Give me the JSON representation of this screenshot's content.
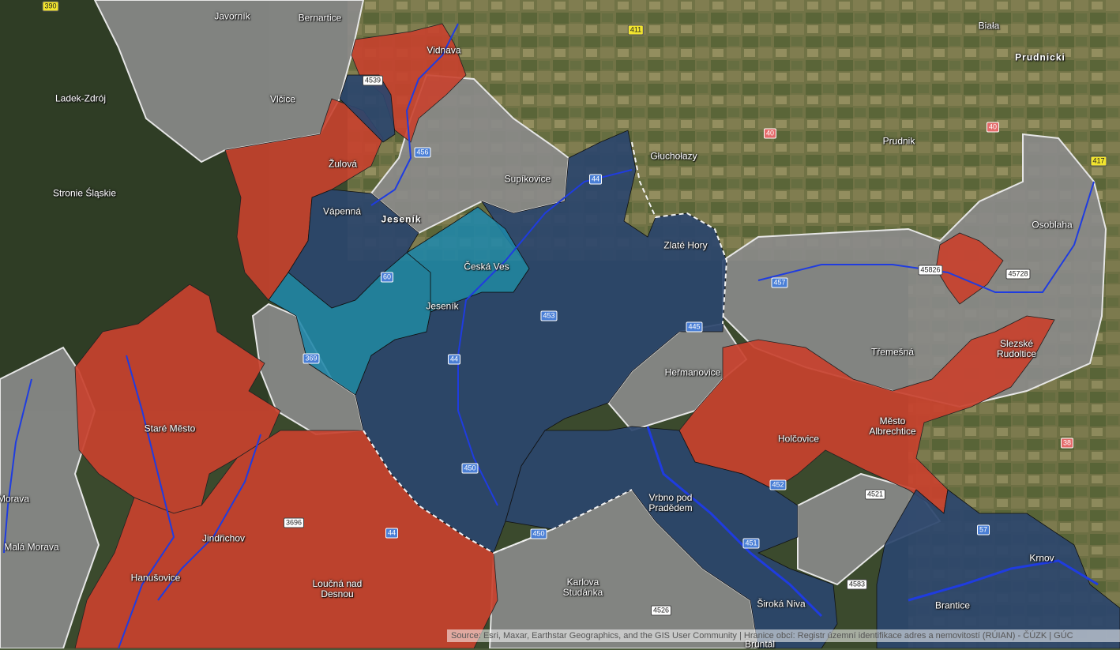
{
  "colors": {
    "red_area": "#c8412e",
    "dark_blue_area": "#2b456d",
    "teal_area": "#1f86a8",
    "gray_area": "#8b8b8b",
    "river": "#1f3ce0",
    "border": "#e6e6e6"
  },
  "places": [
    {
      "id": "javornik",
      "name": "Javorník"
    },
    {
      "id": "bernartice",
      "name": "Bernartice"
    },
    {
      "id": "vidnava",
      "name": "Vidnava"
    },
    {
      "id": "ladek",
      "name": "Ladek-Zdrój"
    },
    {
      "id": "vicice",
      "name": "Vlčice"
    },
    {
      "id": "zulova",
      "name": "Žulová"
    },
    {
      "id": "stronie",
      "name": "Stronie Śląskie"
    },
    {
      "id": "vapenna",
      "name": "Vápenná"
    },
    {
      "id": "jesenik-region",
      "name": "Jeseník",
      "bold": true
    },
    {
      "id": "supikovice",
      "name": "Supíkovice"
    },
    {
      "id": "glucholazy",
      "name": "Głuchołazy"
    },
    {
      "id": "biala",
      "name": "Biała"
    },
    {
      "id": "prudnicki",
      "name": "Prudnicki",
      "bold": true
    },
    {
      "id": "prudnik",
      "name": "Prudnik"
    },
    {
      "id": "osoblaha",
      "name": "Osoblaha"
    },
    {
      "id": "zlate-hory",
      "name": "Zlaté Hory"
    },
    {
      "id": "ceska-ves",
      "name": "Česká Ves"
    },
    {
      "id": "jesenik",
      "name": "Jeseník"
    },
    {
      "id": "tremesna",
      "name": "Třemešná"
    },
    {
      "id": "slezske-rudoltice",
      "name": "Slezské Rudoltice"
    },
    {
      "id": "hermanovice",
      "name": "Heřmanovice"
    },
    {
      "id": "stare-mesto",
      "name": "Staré Město"
    },
    {
      "id": "mesto-albrechtice",
      "name": "Město Albrechtice"
    },
    {
      "id": "holcovice",
      "name": "Holčovice"
    },
    {
      "id": "morava",
      "name": "Morava"
    },
    {
      "id": "mala-morava",
      "name": "Malá Morava"
    },
    {
      "id": "jindrichov",
      "name": "Jindřichov"
    },
    {
      "id": "vrbno",
      "name": "Vrbno pod Pradědem"
    },
    {
      "id": "krnov",
      "name": "Krnov"
    },
    {
      "id": "hanusovice",
      "name": "Hanušovice"
    },
    {
      "id": "loucna",
      "name": "Loučná nad Desnou"
    },
    {
      "id": "karlova",
      "name": "Karlova Studánka"
    },
    {
      "id": "siroka-niva",
      "name": "Široká Niva"
    },
    {
      "id": "brantice",
      "name": "Brantice"
    },
    {
      "id": "bruntal",
      "name": "Bruntál"
    }
  ],
  "road_shields": [
    {
      "id": "r390",
      "label": "390",
      "style": "yellow"
    },
    {
      "id": "r411",
      "label": "411",
      "style": "yellow"
    },
    {
      "id": "r4539",
      "label": "4539",
      "style": "white"
    },
    {
      "id": "r456",
      "label": "456",
      "style": "blue"
    },
    {
      "id": "r40a",
      "label": "40",
      "style": "red"
    },
    {
      "id": "r40b",
      "label": "40",
      "style": "red"
    },
    {
      "id": "r417",
      "label": "417",
      "style": "yellow"
    },
    {
      "id": "r44a",
      "label": "44",
      "style": "blue"
    },
    {
      "id": "r60",
      "label": "60",
      "style": "blue"
    },
    {
      "id": "r457",
      "label": "457",
      "style": "blue"
    },
    {
      "id": "r45826",
      "label": "45826",
      "style": "white"
    },
    {
      "id": "r45728",
      "label": "45728",
      "style": "white"
    },
    {
      "id": "r453",
      "label": "453",
      "style": "blue"
    },
    {
      "id": "r445",
      "label": "445",
      "style": "blue"
    },
    {
      "id": "r369",
      "label": "369",
      "style": "blue"
    },
    {
      "id": "r44b",
      "label": "44",
      "style": "blue"
    },
    {
      "id": "r38",
      "label": "38",
      "style": "red"
    },
    {
      "id": "r450a",
      "label": "450",
      "style": "blue"
    },
    {
      "id": "r452",
      "label": "452",
      "style": "blue"
    },
    {
      "id": "r4521",
      "label": "4521",
      "style": "white"
    },
    {
      "id": "r3696",
      "label": "3696",
      "style": "white"
    },
    {
      "id": "r44c",
      "label": "44",
      "style": "blue"
    },
    {
      "id": "r450b",
      "label": "450",
      "style": "blue"
    },
    {
      "id": "r57",
      "label": "57",
      "style": "blue"
    },
    {
      "id": "r451",
      "label": "451",
      "style": "blue"
    },
    {
      "id": "r4583",
      "label": "4583",
      "style": "white"
    },
    {
      "id": "r4526",
      "label": "4526",
      "style": "white"
    }
  ],
  "attribution": "Source: Esri, Maxar, Earthstar Geographics, and the GIS User Community | Hranice obcí: Registr územní identifikace adres a nemovitostí (RÚIAN) - ČÚZK | GÚC"
}
